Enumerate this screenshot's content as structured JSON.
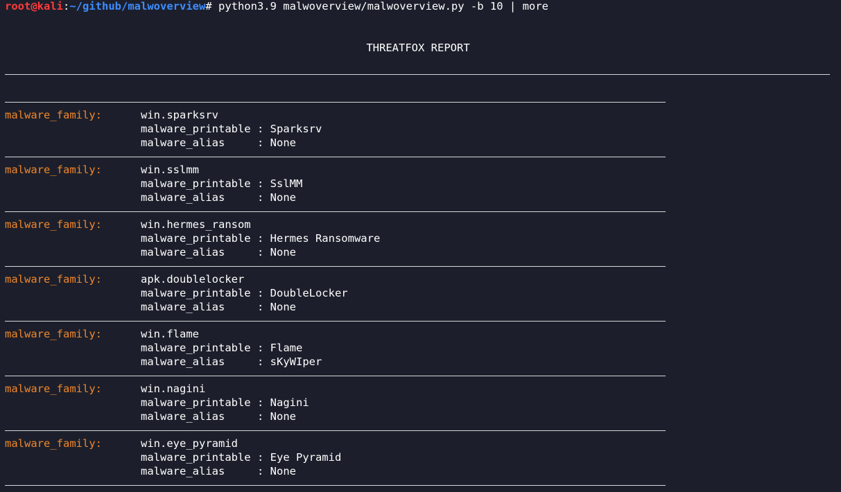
{
  "prompt": {
    "user": "root@kali",
    "separator": ":",
    "path": "~/github/malwoverview",
    "symbol": "# ",
    "command": "python3.9 malwoverview/malwoverview.py -b 10 | more"
  },
  "report_title": "THREATFOX REPORT",
  "labels": {
    "family_key": "malware_family:",
    "printable_key": "malware_printable :",
    "alias_key": "malware_alias     :"
  },
  "entries": [
    {
      "family": "win.sparksrv",
      "printable": "Sparksrv",
      "alias": "None"
    },
    {
      "family": "win.sslmm",
      "printable": "SslMM",
      "alias": "None"
    },
    {
      "family": "win.hermes_ransom",
      "printable": "Hermes Ransomware",
      "alias": "None"
    },
    {
      "family": "apk.doublelocker",
      "printable": "DoubleLocker",
      "alias": "None"
    },
    {
      "family": "win.flame",
      "printable": "Flame",
      "alias": "sKyWIper"
    },
    {
      "family": "win.nagini",
      "printable": "Nagini",
      "alias": "None"
    },
    {
      "family": "win.eye_pyramid",
      "printable": "Eye Pyramid",
      "alias": "None"
    }
  ]
}
